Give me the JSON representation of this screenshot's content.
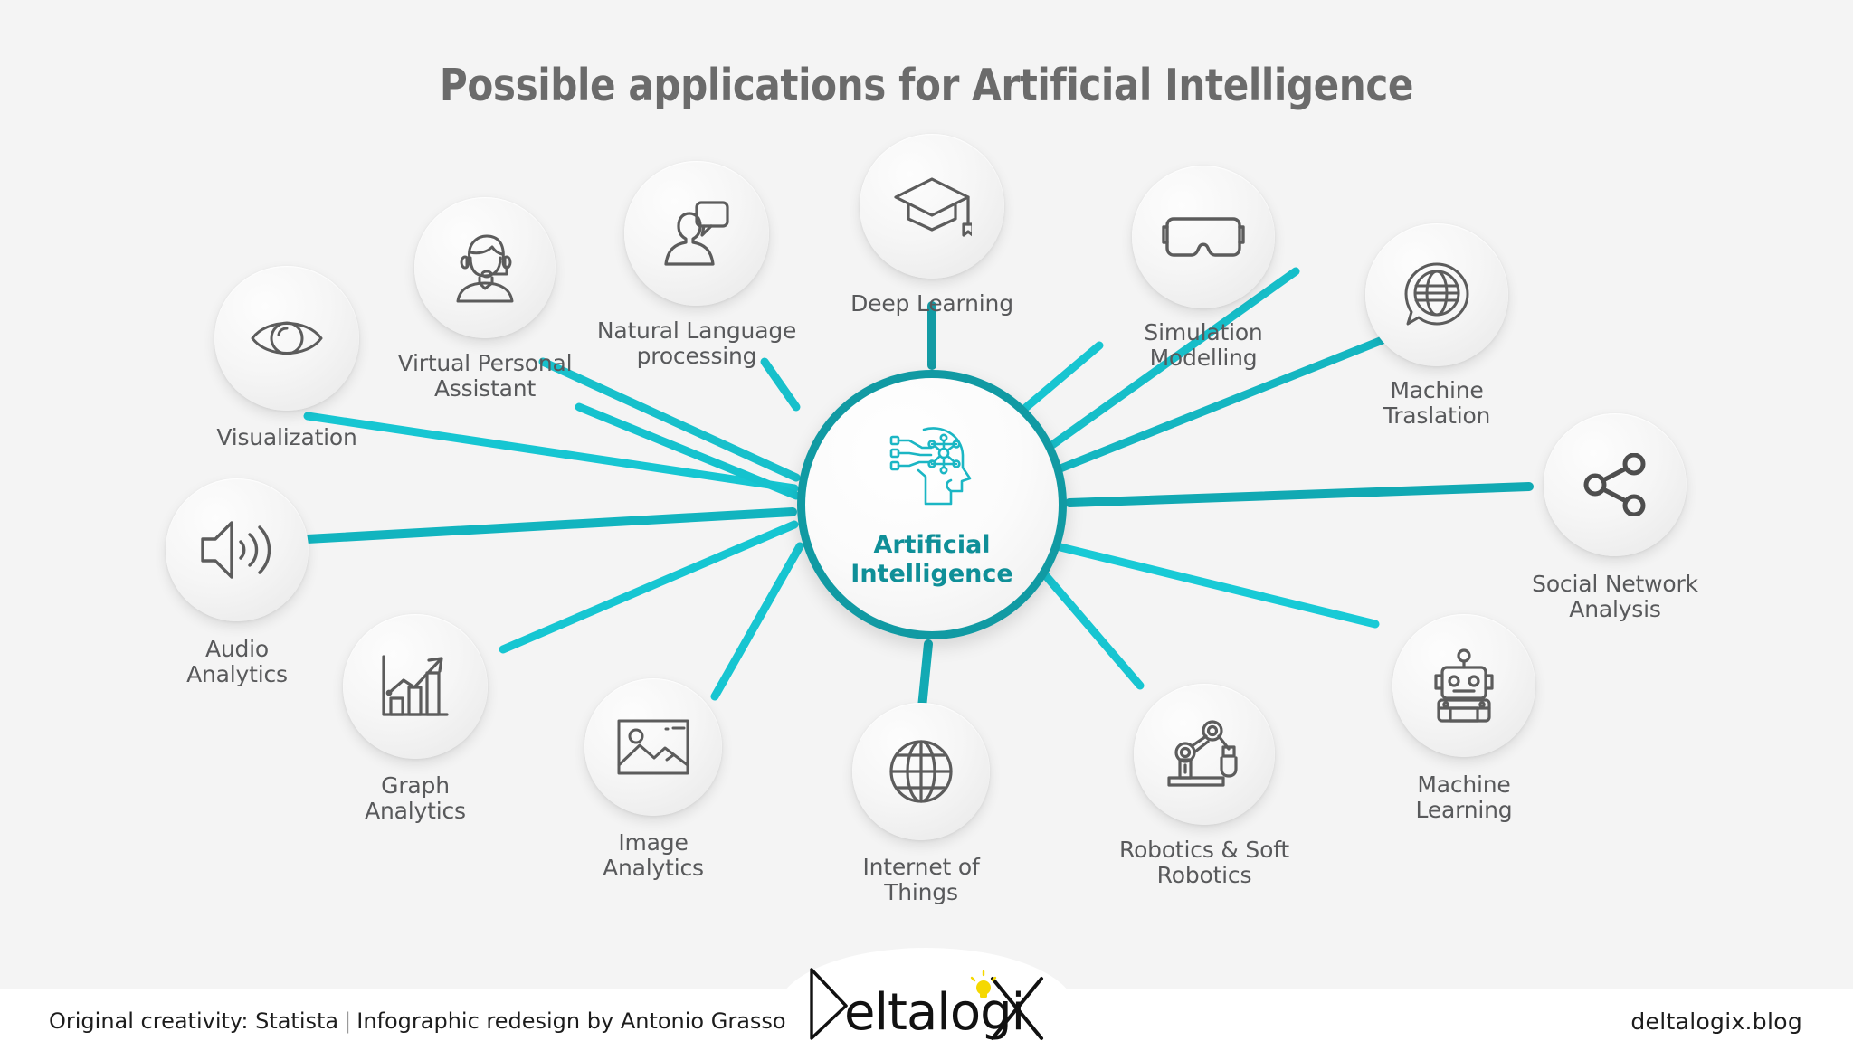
{
  "title": "Possible applications for Artificial Intelligence",
  "colors": {
    "accent_teal": "#119aa3",
    "link_cyan": "#16c6d2",
    "label_gray": "#58595b",
    "title_gray": "#6b6b6b",
    "logo_yellow": "#f5d800",
    "background": "#f4f4f4"
  },
  "center": {
    "label": "Artificial\nIntelligence",
    "icon": "ai-head-icon"
  },
  "nodes": [
    {
      "id": "visualization",
      "label": "Visualization",
      "icon": "eye-icon"
    },
    {
      "id": "virtual-assistant",
      "label": "Virtual Personal\nAssistant",
      "icon": "headset-agent-icon"
    },
    {
      "id": "nlp",
      "label": "Natural Language\nprocessing",
      "icon": "person-speech-bubble-icon"
    },
    {
      "id": "deep-learning",
      "label": "Deep Learning",
      "icon": "graduation-cap-icon"
    },
    {
      "id": "simulation-modelling",
      "label": "Simulation\nModelling",
      "icon": "vr-goggles-icon"
    },
    {
      "id": "machine-translation",
      "label": "Machine\nTraslation",
      "icon": "globe-speech-bubble-icon"
    },
    {
      "id": "social-network",
      "label": "Social Network\nAnalysis",
      "icon": "share-nodes-icon"
    },
    {
      "id": "machine-learning",
      "label": "Machine\nLearning",
      "icon": "robot-icon"
    },
    {
      "id": "robotics",
      "label": "Robotics & Soft\nRobotics",
      "icon": "robot-arm-icon"
    },
    {
      "id": "iot",
      "label": "Internet of\nThings",
      "icon": "globe-icon"
    },
    {
      "id": "image-analytics",
      "label": "Image\nAnalytics",
      "icon": "picture-icon"
    },
    {
      "id": "graph-analytics",
      "label": "Graph\nAnalytics",
      "icon": "bar-chart-arrow-icon"
    },
    {
      "id": "audio-analytics",
      "label": "Audio\nAnalytics",
      "icon": "speaker-icon"
    }
  ],
  "footer": {
    "credit_left": "Original creativity: Statista",
    "credit_separator": "|",
    "credit_right": "Infographic redesign by Antonio Grasso",
    "site": "deltalogix.blog",
    "logo_text": "Deltalogi",
    "logo_x": "X"
  }
}
